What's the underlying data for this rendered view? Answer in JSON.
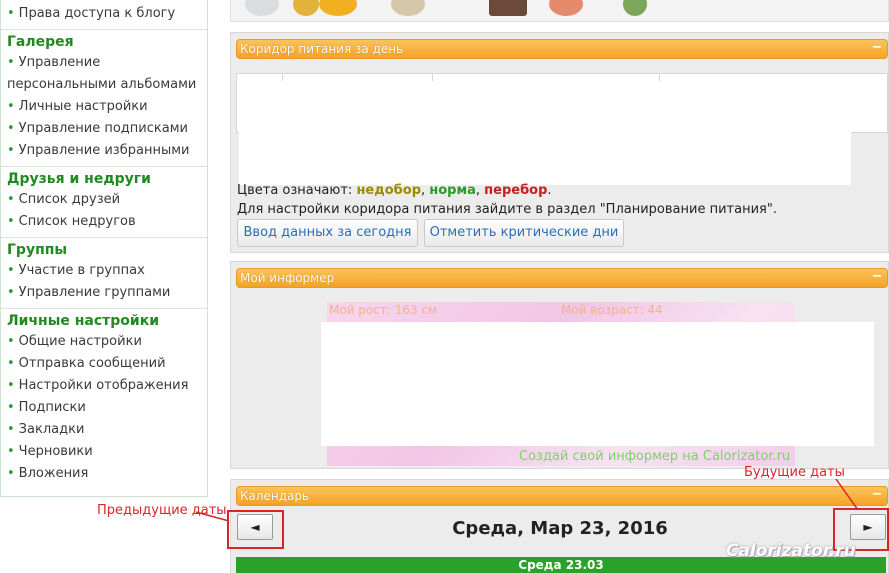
{
  "sidebar": {
    "top_item": "Права доступа к блогу",
    "sections": [
      {
        "title": "Галерея",
        "items": [
          "Управление персональными альбомами",
          "Личные настройки",
          "Управление подписками",
          "Управление избранными"
        ]
      },
      {
        "title": "Друзья и недруги",
        "items": [
          "Список друзей",
          "Список недругов"
        ]
      },
      {
        "title": "Группы",
        "items": [
          "Участие в группах",
          "Управление группами"
        ]
      },
      {
        "title": "Личные настройки",
        "items": [
          "Общие настройки",
          "Отправка сообщений",
          "Настройки отображения",
          "Подписки",
          "Закладки",
          "Черновики",
          "Вложения"
        ]
      }
    ]
  },
  "panel_nutrition": {
    "title": "Коридор питания за день",
    "minimize": "−",
    "legend_prefix": "Цвета означают:",
    "legend_under": "недобор",
    "legend_norm": "норма",
    "legend_over": "перебор",
    "hint": "Для настройки коридора питания зайдите в раздел \"Планирование питания\".",
    "btn_today": "Ввод данных за сегодня",
    "btn_critical": "Отметить критические дни"
  },
  "panel_informer": {
    "title": "Мой информер",
    "minimize": "−",
    "line1": "Мой рост: 163 см",
    "line2": "Мой возраст: 44",
    "footer": "Создай свой информер на Calorizator.ru"
  },
  "panel_calendar": {
    "title": "Календарь",
    "minimize": "−",
    "prev": "◄",
    "next": "►",
    "date": "Среда, Мар 23, 2016",
    "day_bar": "Среда 23.03"
  },
  "annotations": {
    "prev_label": "Предыдущие даты",
    "next_label": "Будущие даты",
    "color": "#d8252a"
  },
  "watermark": "Calorizator.ru",
  "colors": {
    "header_orange": "#f4a326",
    "sidebar_green": "#1f8a1f",
    "day_green": "#2aa12a",
    "link_blue": "#2a6fb5"
  }
}
